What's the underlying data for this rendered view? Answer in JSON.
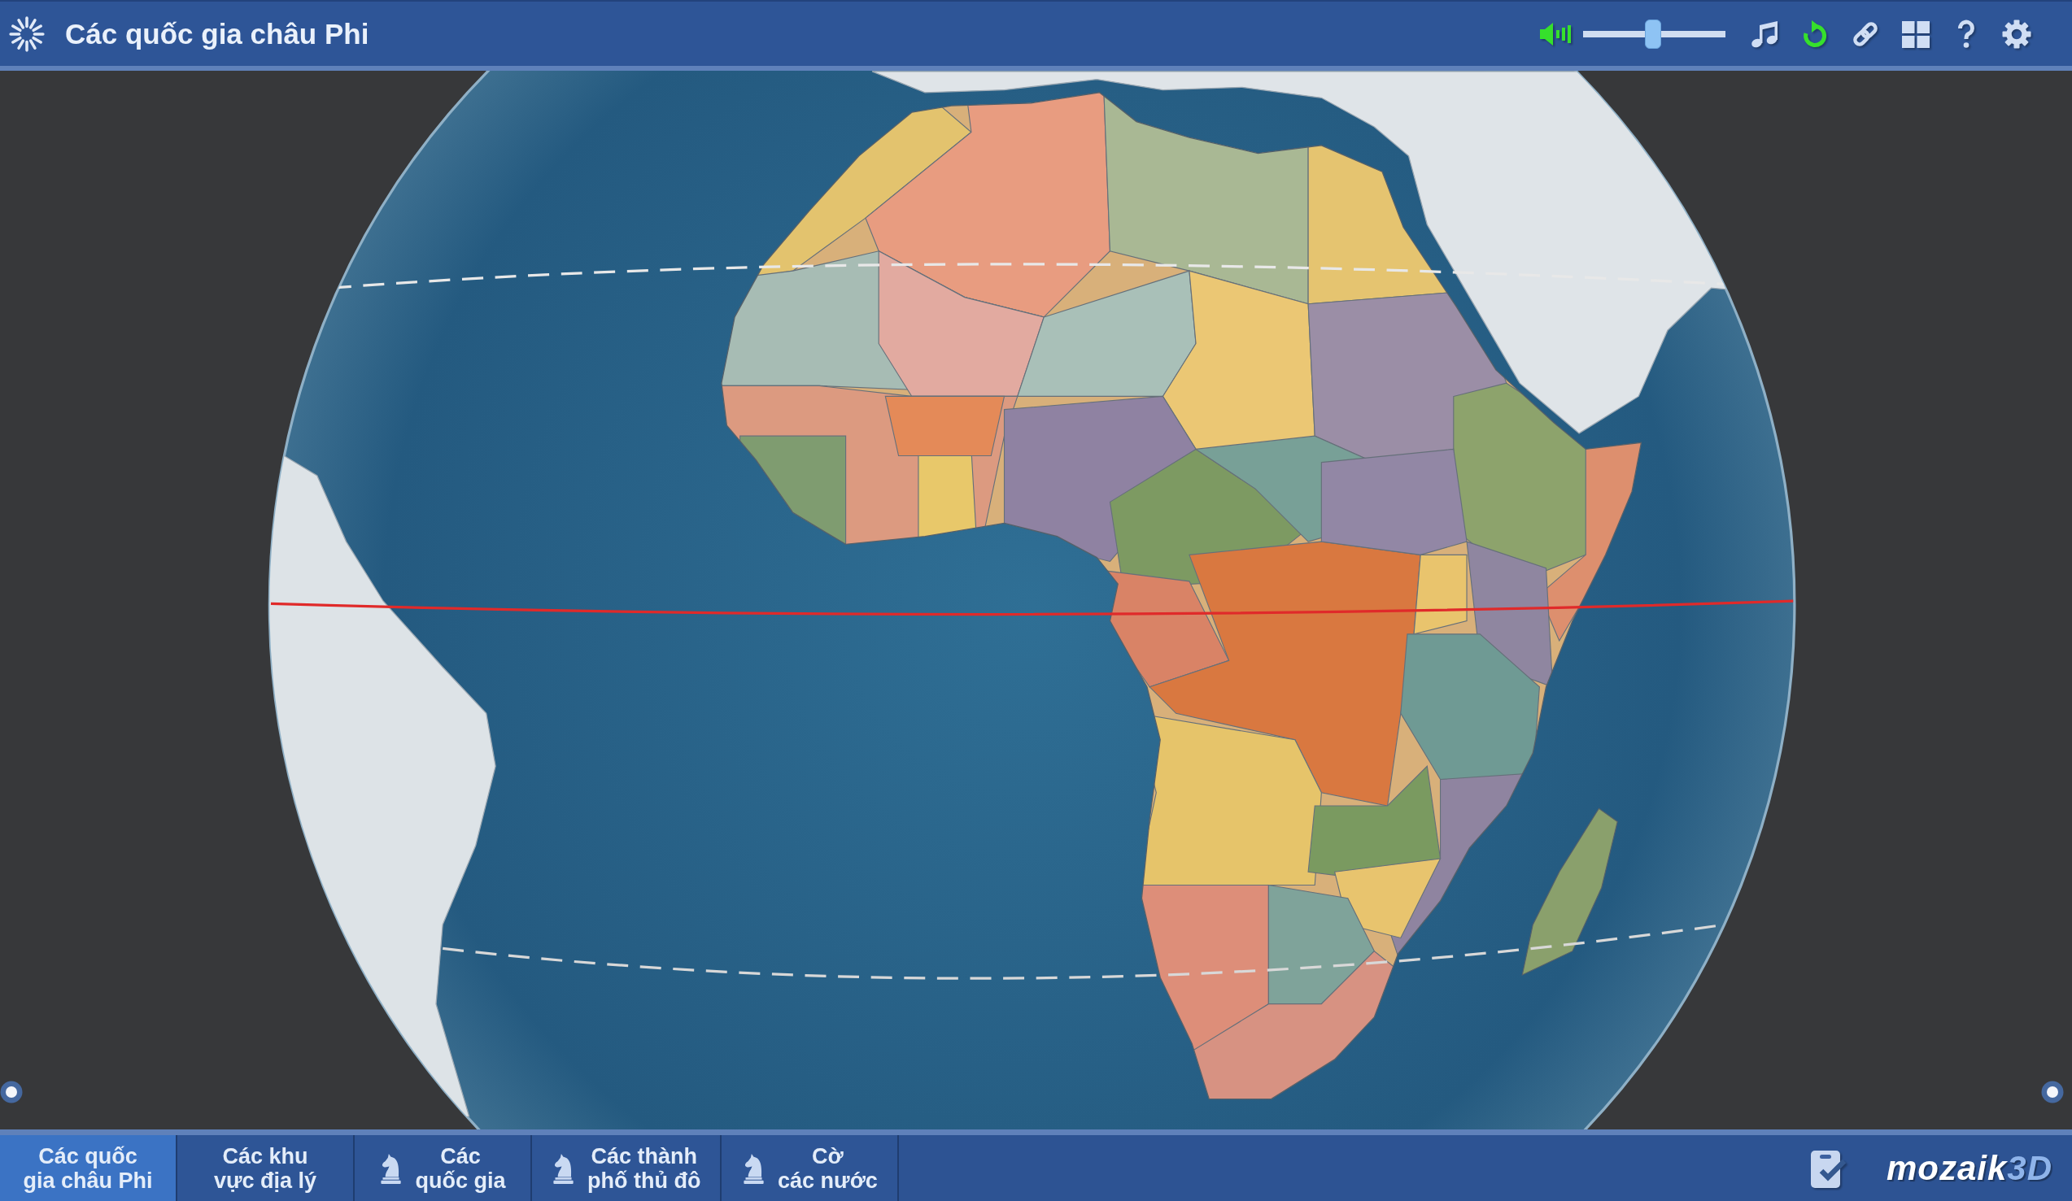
{
  "header": {
    "title": "Các quốc gia châu Phi"
  },
  "toolbar": {
    "sound_on": true,
    "volume": {
      "level": 0.49
    },
    "buttons": [
      {
        "kind": "music",
        "on": false
      },
      {
        "kind": "rotate",
        "on": true
      },
      {
        "kind": "link",
        "on": false
      },
      {
        "kind": "layout",
        "on": false
      },
      {
        "kind": "help",
        "on": false
      },
      {
        "kind": "settings",
        "on": false
      }
    ]
  },
  "tabs": [
    {
      "label": "Các quốc\ngia châu Phi",
      "kind": "view",
      "selected": true
    },
    {
      "label": "Các khu\nvực địa lý",
      "kind": "view",
      "selected": false
    },
    {
      "label": "Các\nquốc gia",
      "kind": "game",
      "selected": false
    },
    {
      "label": "Các thành\nphố thủ đô",
      "kind": "game",
      "selected": false
    },
    {
      "label": "Cờ\ncác nước",
      "kind": "game",
      "selected": false
    }
  ],
  "brand": {
    "name": "mozaik",
    "suffix": "3D"
  }
}
